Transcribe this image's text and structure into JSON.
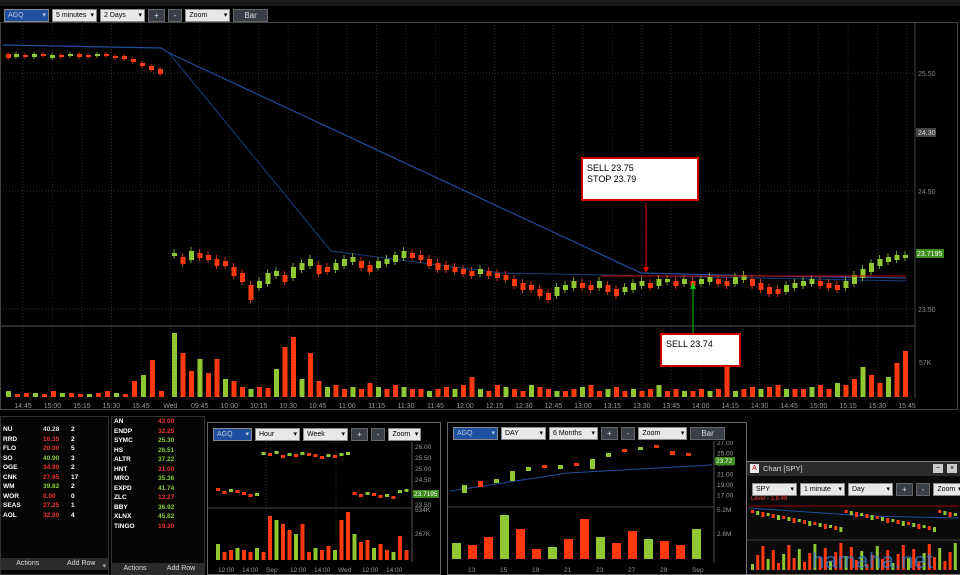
{
  "top_toolbar": {
    "symbol": "AGQ",
    "interval": "5 minutes",
    "range": "2 Days",
    "plus": "+",
    "minus": "-",
    "zoom": "Zoom",
    "type": "Bar"
  },
  "main_chart": {
    "price_labels": [
      "25.50",
      "24.50",
      "23.50"
    ],
    "price_marker": "24.30",
    "last_price": "23.7195",
    "volume_label": "57K",
    "time_labels": [
      "14:45",
      "15:00",
      "15:15",
      "15:30",
      "15:45",
      "Wed",
      "09:45",
      "10:00",
      "10:15",
      "10:30",
      "10:45",
      "11:00",
      "11:15",
      "11:30",
      "11:45",
      "12:00",
      "12:15",
      "12:30",
      "12:45",
      "13:00",
      "13:15",
      "13:30",
      "13:45",
      "14:00",
      "14:15",
      "14:30",
      "14:45",
      "15:00",
      "15:15",
      "15:30",
      "15:45"
    ],
    "callout_top": {
      "line1": "SELL  23.75",
      "line2": "STOP 23.79"
    },
    "callout_bottom": {
      "line1": "SELL 23.74"
    }
  },
  "watchlist_left": [
    {
      "sym": "NU",
      "price": "40.28",
      "qty": "2",
      "color": "#ddd"
    },
    {
      "sym": "RRD",
      "price": "16.35",
      "qty": "2",
      "color": "#e33"
    },
    {
      "sym": "FLO",
      "price": "20.00",
      "qty": "5",
      "color": "#e33"
    },
    {
      "sym": "SO",
      "price": "40.90",
      "qty": "3",
      "color": "#8c3"
    },
    {
      "sym": "OGE",
      "price": "34.90",
      "qty": "2",
      "color": "#e33"
    },
    {
      "sym": "CNK",
      "price": "27.95",
      "qty": "17",
      "color": "#e33"
    },
    {
      "sym": "WM",
      "price": "39.82",
      "qty": "2",
      "color": "#8c3"
    },
    {
      "sym": "WOR",
      "price": "0.00",
      "qty": "0",
      "color": "#e33"
    },
    {
      "sym": "SEAS",
      "price": "27.25",
      "qty": "1",
      "color": "#e33"
    },
    {
      "sym": "AOL",
      "price": "32.00",
      "qty": "4",
      "color": "#e33"
    }
  ],
  "watchlist_right": [
    {
      "sym": "AN",
      "price": "43.00",
      "color": "#e33"
    },
    {
      "sym": "ENDP",
      "price": "32.25",
      "color": "#e33"
    },
    {
      "sym": "SYMC",
      "price": "25.30",
      "color": "#8c3"
    },
    {
      "sym": "HS",
      "price": "26.51",
      "color": "#8c3"
    },
    {
      "sym": "ALTR",
      "price": "37.22",
      "color": "#8c3"
    },
    {
      "sym": "HNT",
      "price": "31.00",
      "color": "#e33"
    },
    {
      "sym": "MRO",
      "price": "35.36",
      "color": "#8c3"
    },
    {
      "sym": "EXPD",
      "price": "41.74",
      "color": "#8c3"
    },
    {
      "sym": "ZLC",
      "price": "13.27",
      "color": "#e33"
    },
    {
      "sym": "BBY",
      "price": "36.92",
      "color": "#8c3"
    },
    {
      "sym": "XLNX",
      "price": "45.82",
      "color": "#8c3"
    },
    {
      "sym": "TINGO",
      "price": "19.30",
      "color": "#e33"
    }
  ],
  "watchlist_actions": {
    "actions": "Actions",
    "add_row": "Add Row"
  },
  "chart2": {
    "symbol": "AGQ",
    "interval": "Hour",
    "range": "Week",
    "zoom": "Zoom",
    "price_labels": [
      "26.00",
      "25.50",
      "25.00",
      "24.50",
      "23.50"
    ],
    "last": "23.7195",
    "vol_labels": [
      "534K",
      "267K"
    ],
    "time_labels": [
      "12:00",
      "14:00",
      "Sep",
      "12:00",
      "14:00",
      "Wed",
      "12:00",
      "14:00"
    ]
  },
  "chart3": {
    "symbol": "AGQ",
    "interval": "DAY",
    "range": "6 Months",
    "zoom": "Zoom",
    "type": "Bar",
    "price_labels": [
      "27.00",
      "25.00",
      "23.00",
      "21.00",
      "19.00",
      "17.00"
    ],
    "last": "23.72",
    "vol_labels": [
      "5.2M",
      "2.6M"
    ],
    "time_labels": [
      "13",
      "15",
      "19",
      "21",
      "23",
      "27",
      "29",
      "Sep"
    ]
  },
  "chart4": {
    "title": "Chart [SPY]",
    "symbol": "SPY",
    "interval": "1 minute",
    "range": "Day",
    "zoom": "Zoom",
    "level": "Level - 1.8.48"
  },
  "watermark": "hamaha.net",
  "colors": {
    "up": "#8fc830",
    "down": "#ff3a10",
    "ma": "#1f4e9c",
    "callout": "#cc0000"
  }
}
